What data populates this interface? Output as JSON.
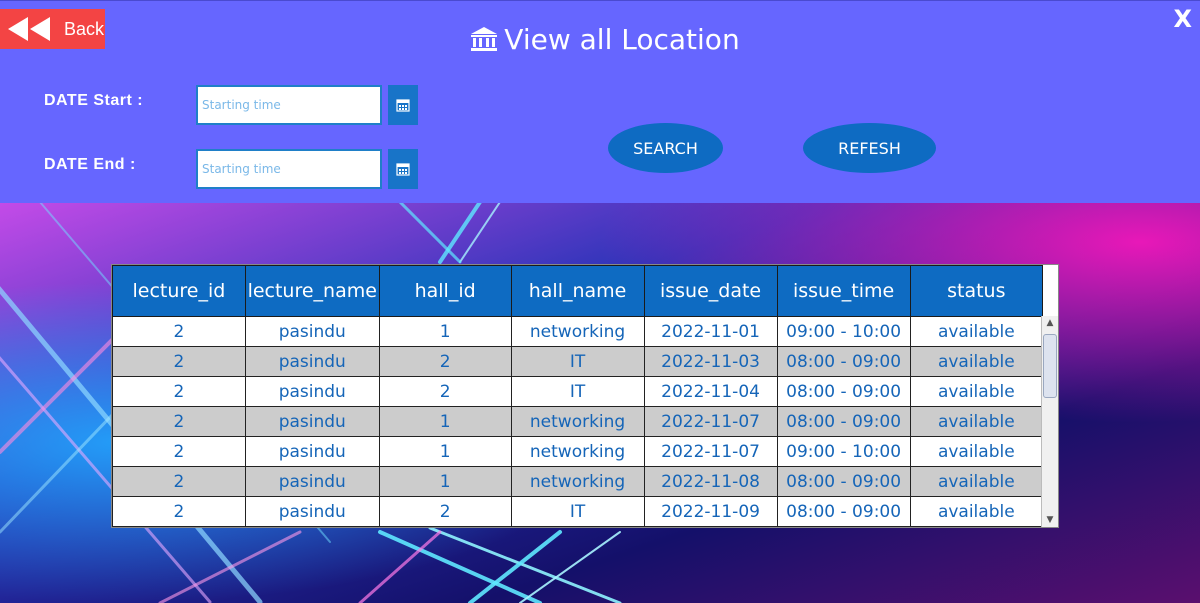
{
  "header": {
    "title": "View all Location",
    "back_label": "Back",
    "close_label": "X"
  },
  "filters": {
    "start_label": "DATE Start :",
    "end_label": "DATE End :",
    "start_placeholder": "Starting time",
    "end_placeholder": "Starting time",
    "search_label": "SEARCH",
    "refresh_label": "REFESH"
  },
  "table": {
    "columns": [
      "lecture_id",
      "lecture_name",
      "hall_id",
      "hall_name",
      "issue_date",
      "issue_time",
      "status"
    ],
    "rows": [
      [
        "2",
        "pasindu",
        "1",
        "networking",
        "2022-11-01",
        "09:00 - 10:00",
        "available"
      ],
      [
        "2",
        "pasindu",
        "2",
        "IT",
        "2022-11-03",
        "08:00 - 09:00",
        "available"
      ],
      [
        "2",
        "pasindu",
        "2",
        "IT",
        "2022-11-04",
        "08:00 - 09:00",
        "available"
      ],
      [
        "2",
        "pasindu",
        "1",
        "networking",
        "2022-11-07",
        "08:00 - 09:00",
        "available"
      ],
      [
        "2",
        "pasindu",
        "1",
        "networking",
        "2022-11-07",
        "09:00 - 10:00",
        "available"
      ],
      [
        "2",
        "pasindu",
        "1",
        "networking",
        "2022-11-08",
        "08:00 - 09:00",
        "available"
      ],
      [
        "2",
        "pasindu",
        "2",
        "IT",
        "2022-11-09",
        "08:00 - 09:00",
        "available"
      ]
    ]
  },
  "colors": {
    "header_bg": "#6666ff",
    "accent": "#0e6bc2",
    "back_bg": "#f34444",
    "cell_text": "#1565b8"
  }
}
